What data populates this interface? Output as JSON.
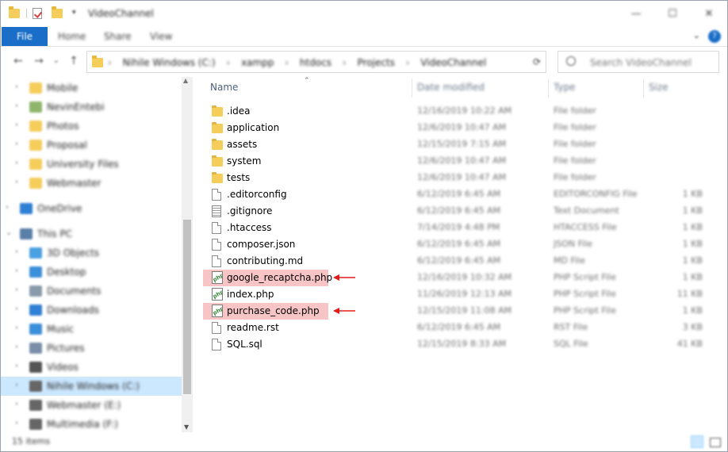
{
  "window": {
    "title": "VideoChannel",
    "minimize": "—",
    "maximize": "☐",
    "close": "✕"
  },
  "ribbon": {
    "file": "File",
    "tabs": [
      "Home",
      "Share",
      "View"
    ],
    "help": "?",
    "collapse": "⌄"
  },
  "address": {
    "crumbs": [
      "Nihile Windows (C:)",
      "xampp",
      "htdocs",
      "Projects",
      "VideoChannel"
    ],
    "search_placeholder": "Search VideoChannel"
  },
  "nav": {
    "items": [
      {
        "label": "Mobile",
        "color": "#f5cd5b"
      },
      {
        "label": "NevinEntebi",
        "color": "#8fb56b"
      },
      {
        "label": "Photos",
        "color": "#f5cd5b"
      },
      {
        "label": "Proposal",
        "color": "#f5cd5b"
      },
      {
        "label": "University Files",
        "color": "#f5cd5b"
      },
      {
        "label": "Webmaster",
        "color": "#f5cd5b"
      },
      {
        "label": "OneDrive",
        "color": "#2f7fd4"
      },
      {
        "label": "This PC",
        "color": "#5a7fa8"
      },
      {
        "label": "3D Objects",
        "color": "#4aa0e0"
      },
      {
        "label": "Desktop",
        "color": "#3b8ed8"
      },
      {
        "label": "Documents",
        "color": "#8899aa"
      },
      {
        "label": "Downloads",
        "color": "#2f7fd4"
      },
      {
        "label": "Music",
        "color": "#3b8ed8"
      },
      {
        "label": "Pictures",
        "color": "#7a8ea8"
      },
      {
        "label": "Videos",
        "color": "#555555"
      },
      {
        "label": "Nihile Windows (C:)",
        "color": "#666666"
      },
      {
        "label": "Webmaster (E:)",
        "color": "#666666"
      },
      {
        "label": "Multimedia (F:)",
        "color": "#666666"
      }
    ]
  },
  "columns": {
    "name": "Name",
    "date": "Date modified",
    "type": "Type",
    "size": "Size"
  },
  "files": [
    {
      "name": ".idea",
      "date": "12/16/2019 10:22 AM",
      "type": "File folder",
      "size": "",
      "icon": "folder"
    },
    {
      "name": "application",
      "date": "12/6/2019 10:47 AM",
      "type": "File folder",
      "size": "",
      "icon": "folder"
    },
    {
      "name": "assets",
      "date": "12/15/2019 7:15 AM",
      "type": "File folder",
      "size": "",
      "icon": "folder"
    },
    {
      "name": "system",
      "date": "12/6/2019 10:47 AM",
      "type": "File folder",
      "size": "",
      "icon": "folder"
    },
    {
      "name": "tests",
      "date": "12/6/2019 10:47 AM",
      "type": "File folder",
      "size": "",
      "icon": "folder"
    },
    {
      "name": ".editorconfig",
      "date": "6/12/2019 6:45 AM",
      "type": "EDITORCONFIG File",
      "size": "1 KB",
      "icon": "file"
    },
    {
      "name": ".gitignore",
      "date": "6/12/2019 6:45 AM",
      "type": "Text Document",
      "size": "1 KB",
      "icon": "text"
    },
    {
      "name": ".htaccess",
      "date": "7/14/2019 4:48 PM",
      "type": "HTACCESS File",
      "size": "1 KB",
      "icon": "file"
    },
    {
      "name": "composer.json",
      "date": "6/12/2019 6:45 AM",
      "type": "JSON File",
      "size": "1 KB",
      "icon": "file"
    },
    {
      "name": "contributing.md",
      "date": "6/12/2019 6:45 AM",
      "type": "MD File",
      "size": "1 KB",
      "icon": "file"
    },
    {
      "name": "google_recaptcha.php",
      "date": "12/16/2019 10:32 AM",
      "type": "PHP Script File",
      "size": "1 KB",
      "icon": "php",
      "highlight": true
    },
    {
      "name": "index.php",
      "date": "11/26/2019 12:13 AM",
      "type": "PHP Script File",
      "size": "11 KB",
      "icon": "php"
    },
    {
      "name": "purchase_code.php",
      "date": "12/15/2019 11:08 AM",
      "type": "PHP Script File",
      "size": "1 KB",
      "icon": "php",
      "highlight": true
    },
    {
      "name": "readme.rst",
      "date": "6/12/2019 6:45 AM",
      "type": "RST File",
      "size": "3 KB",
      "icon": "file"
    },
    {
      "name": "SQL.sql",
      "date": "12/15/2019 8:33 AM",
      "type": "SQL File",
      "size": "41 KB",
      "icon": "file"
    }
  ],
  "php_label": "php",
  "status": {
    "items": "15 items"
  },
  "colors": {
    "accent": "#1a6ec7",
    "highlight": "#f7c5c5",
    "arrow": "#e01b1b",
    "selection": "#cce8ff"
  }
}
